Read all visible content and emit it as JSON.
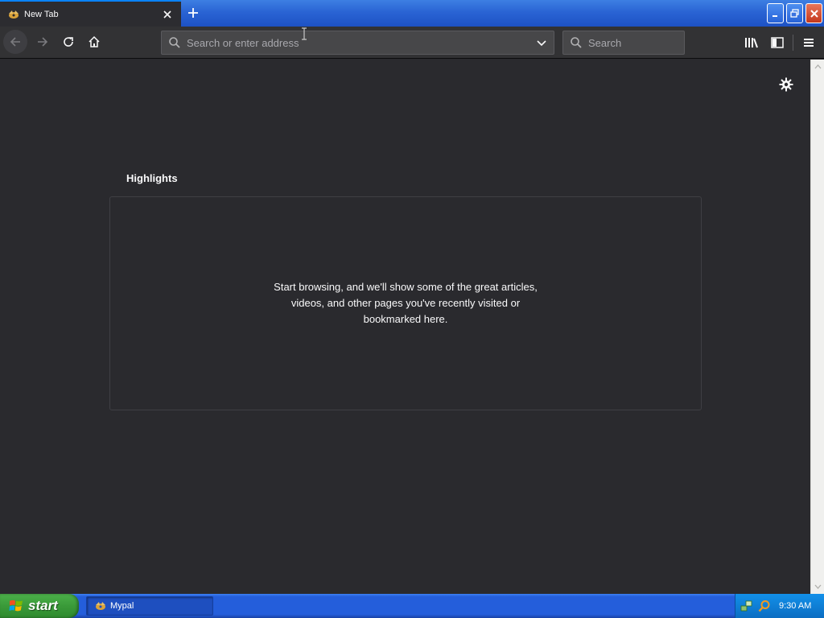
{
  "window": {
    "tab_title": "New Tab"
  },
  "toolbar": {
    "url_placeholder": "Search or enter address",
    "search_placeholder": "Search"
  },
  "content": {
    "section_title": "Highlights",
    "empty_message": "Start browsing, and we'll show some of the great articles, videos, and other pages you've recently visited or bookmarked here."
  },
  "taskbar": {
    "start_label": "start",
    "task_label": "Mypal",
    "clock": "9:30 AM"
  },
  "icons": {
    "tab_favicon": "mypal-logo-icon",
    "back": "back-arrow-icon",
    "forward": "forward-arrow-icon",
    "reload": "reload-icon",
    "home": "home-icon",
    "library": "library-icon",
    "sidebar": "sidebar-icon",
    "menu": "hamburger-menu-icon",
    "settings": "gear-icon"
  },
  "colors": {
    "page_background": "#2a2a2e",
    "toolbar_background": "#323234",
    "tab_accent": "#0a84ff",
    "title_bar_blue": "#245edb",
    "start_green": "#3a9a39",
    "close_red": "#c4381c"
  }
}
